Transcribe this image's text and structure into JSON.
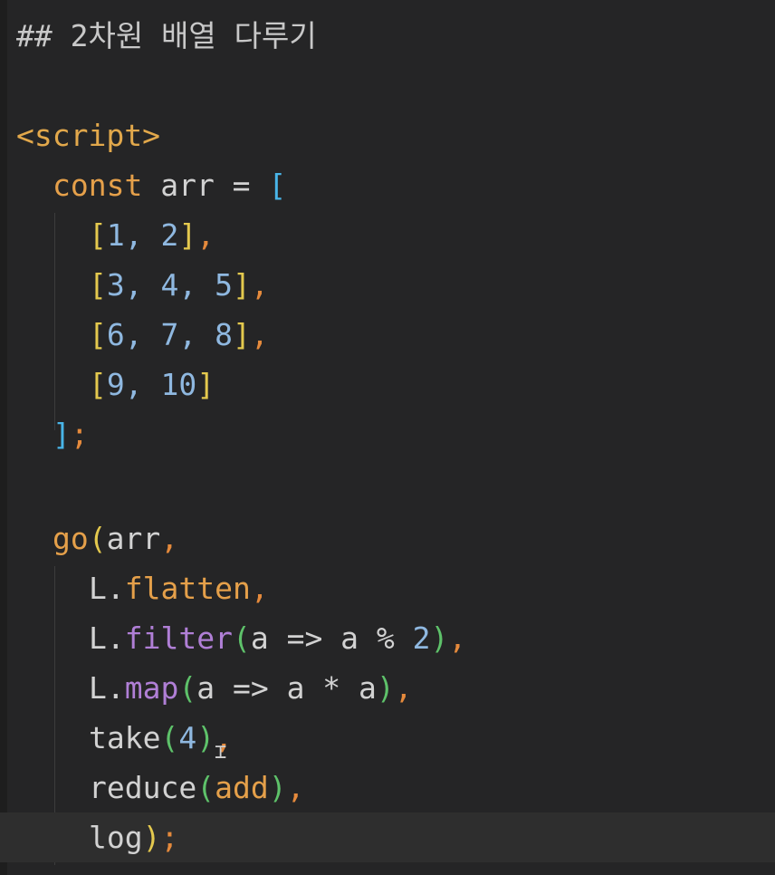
{
  "editor": {
    "heading": "## 2차원 배열 다루기",
    "lines": {
      "script_tag": "<script>",
      "const_kw": "const",
      "arr_decl": " arr = ",
      "open_bracket": "[",
      "row1_open": "[",
      "row1_nums": "1, 2",
      "row1_close": "]",
      "row1_comma": ",",
      "row2_open": "[",
      "row2_nums": "3, 4, 5",
      "row2_close": "]",
      "row2_comma": ",",
      "row3_open": "[",
      "row3_nums": "6, 7, 8",
      "row3_close": "]",
      "row3_comma": ",",
      "row4_open": "[",
      "row4_a": "9, ",
      "row4_b": "10",
      "row4_close": "]",
      "close_bracket": "]",
      "semicolon": ";",
      "go_fn": "go",
      "go_paren": "(",
      "go_arg": "arr",
      "go_comma": ",",
      "flatten_obj": "L.",
      "flatten_fn": "flatten",
      "flatten_comma": ",",
      "filter_obj": "L.",
      "filter_fn": "filter",
      "filter_open": "(",
      "filter_body": "a => a % ",
      "filter_num": "2",
      "filter_close": ")",
      "filter_comma": ",",
      "map_obj": "L.",
      "map_fn": "map",
      "map_open": "(",
      "map_body": "a => a * a",
      "map_close": ")",
      "map_comma": ",",
      "take_fn": "take",
      "take_open": "(",
      "take_num": "4",
      "take_close": ")",
      "take_comma": ",",
      "reduce_fn": "reduce",
      "reduce_open": "(",
      "reduce_arg": "add",
      "reduce_close": ")",
      "reduce_comma": ",",
      "log_fn": "log",
      "log_close": ")",
      "log_semicolon": ";"
    }
  }
}
